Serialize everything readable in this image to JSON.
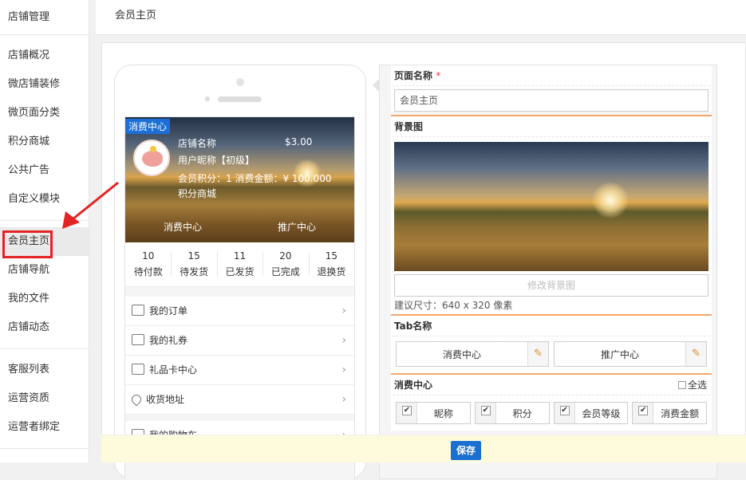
{
  "sidebar": {
    "title": "店铺管理",
    "group1": [
      "店铺概况",
      "微店铺装修",
      "微页面分类",
      "积分商城",
      "公共广告",
      "自定义模块"
    ],
    "group2": [
      "会员主页",
      "店铺导航",
      "我的文件",
      "店铺动态"
    ],
    "group3": [
      "客服列表",
      "运营资质",
      "运营者绑定"
    ]
  },
  "topbar": {
    "title": "会员主页"
  },
  "preview": {
    "badge": "消费中心",
    "store_name": "店铺名称",
    "money": "$3.00",
    "nickname": "用户昵称【初级】",
    "stats": "会员积分：1 消费金额：¥ 100.000",
    "mall": "积分商城",
    "tab1": "消费中心",
    "tab2": "推广中心",
    "orders": [
      {
        "n": "10",
        "l": "待付款"
      },
      {
        "n": "15",
        "l": "待发货"
      },
      {
        "n": "11",
        "l": "已发货"
      },
      {
        "n": "20",
        "l": "已完成"
      },
      {
        "n": "15",
        "l": "退换货"
      }
    ],
    "menu": [
      "我的订单",
      "我的礼券",
      "礼品卡中心",
      "收货地址",
      "我的购物车"
    ]
  },
  "panel": {
    "page_name_label": "页面名称",
    "required_mark": "*",
    "page_name_value": "会员主页",
    "bg_label": "背景图",
    "change_bg": "修改背景图",
    "size_hint": "建议尺寸：640 x 320 像素",
    "tab_label": "Tab名称",
    "tab1": "消费中心",
    "tab2": "推广中心",
    "consume_label": "消费中心",
    "select_all": "全选",
    "fields": [
      "昵称",
      "积分",
      "会员等级",
      "消费金额"
    ]
  },
  "footer": {
    "save": "保存"
  },
  "icons": {
    "pen": "edit-pencil-icon",
    "arrow": "chevron-right-icon"
  }
}
